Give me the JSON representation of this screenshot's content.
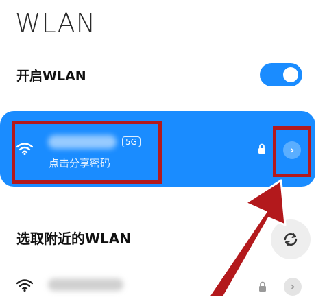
{
  "header": {
    "title": "WLAN"
  },
  "wlan_toggle": {
    "label": "开启WLAN",
    "enabled": true
  },
  "connected_network": {
    "band": "5G",
    "hint": "点击分享密码",
    "detail_glyph": "›",
    "icons": [
      "wifi-icon",
      "lock-icon",
      "chevron-right-icon"
    ]
  },
  "nearby": {
    "label": "选取附近的WLAN",
    "refresh_icon": "refresh-icon"
  },
  "network_list": [
    {
      "arrow_glyph": "›",
      "icons": [
        "wifi-icon",
        "lock-icon",
        "chevron-right-icon"
      ]
    }
  ],
  "colors": {
    "accent": "#1a8cff",
    "annotation": "#b3191c"
  }
}
